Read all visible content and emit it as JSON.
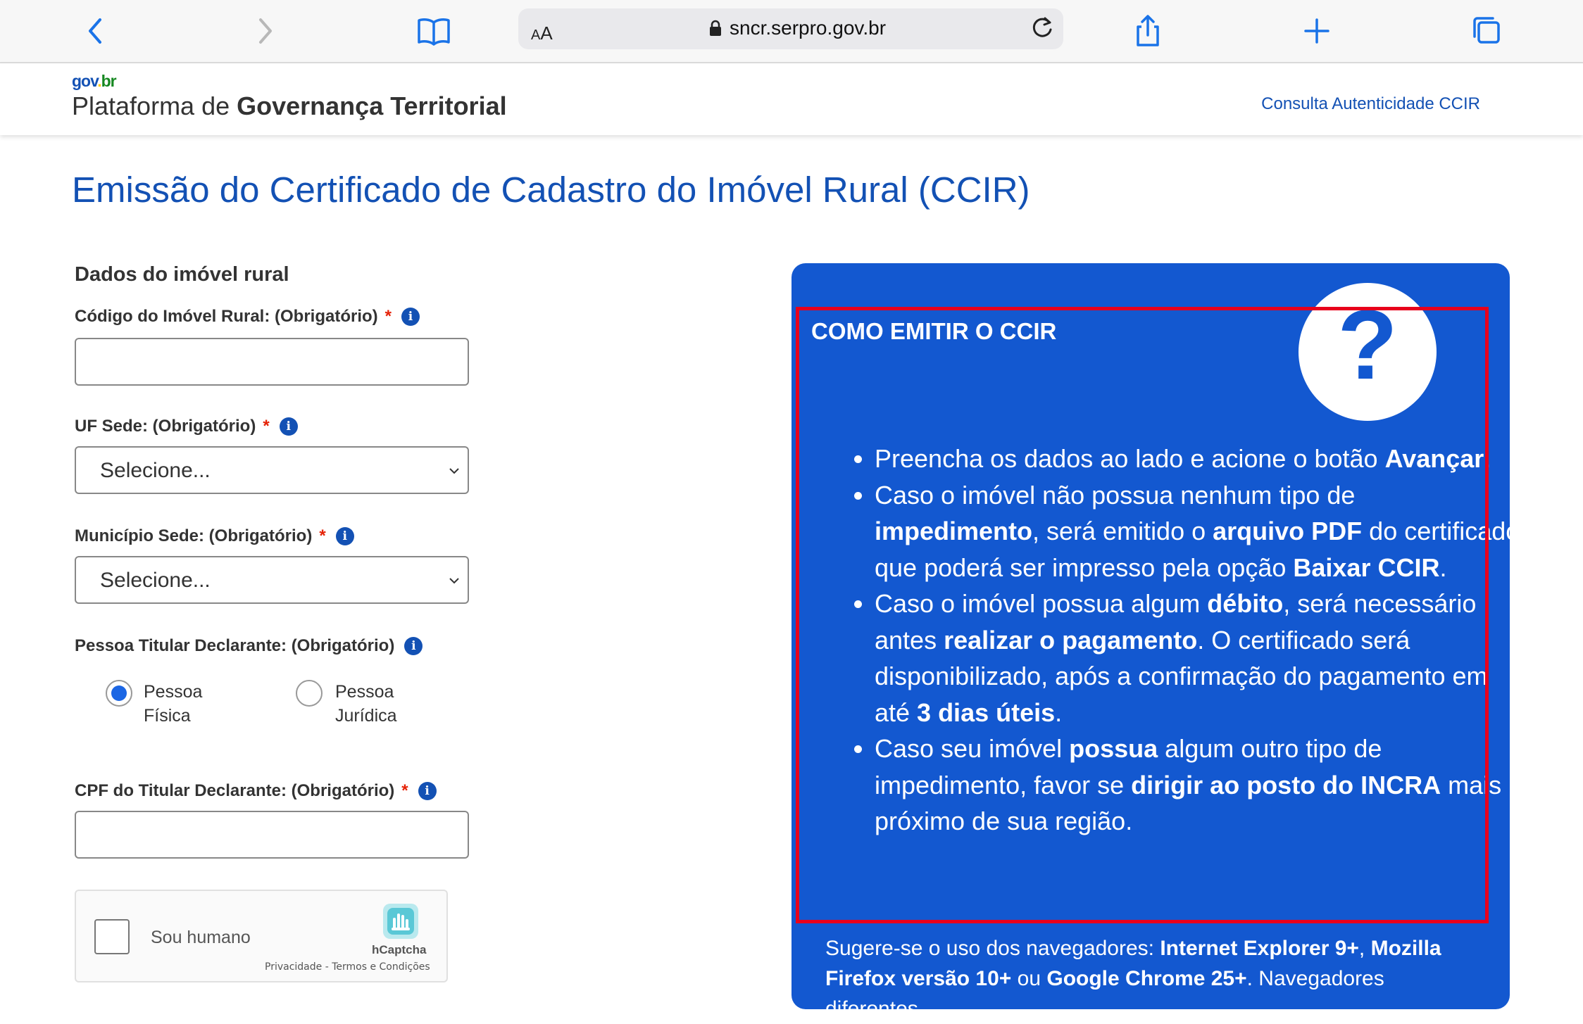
{
  "browser": {
    "address_prefix_small": "A",
    "address_prefix": "A",
    "url": "sncr.serpro.gov.br",
    "icons": [
      "back-icon",
      "forward-icon",
      "bookmarks-icon",
      "lock-icon",
      "reload-icon",
      "share-icon",
      "new-tab-icon",
      "tabs-icon"
    ]
  },
  "header": {
    "logo_gov": "gov",
    "logo_dot": ".",
    "logo_br": "br",
    "platform_prefix": "Plataforma de ",
    "platform_bold": "Governança Territorial",
    "auth_link": "Consulta Autenticidade CCIR"
  },
  "page": {
    "title": "Emissão do Certificado de Cadastro do Imóvel Rural (CCIR)"
  },
  "form": {
    "section_title": "Dados do imóvel rural",
    "required_mark": "*",
    "info_glyph": "i",
    "codigo_label": "Código do Imóvel Rural: (Obrigatório)",
    "codigo_value": "",
    "uf_label": "UF Sede: (Obrigatório)",
    "uf_value": "Selecione...",
    "municipio_label": "Município Sede: (Obrigatório)",
    "municipio_value": "Selecione...",
    "pessoa_label": "Pessoa Titular Declarante: (Obrigatório)",
    "pessoa_options": [
      {
        "line1": "Pessoa",
        "line2": "Física",
        "selected": true
      },
      {
        "line1": "Pessoa",
        "line2": "Jurídica",
        "selected": false
      }
    ],
    "cpf_label": "CPF do Titular Declarante: (Obrigatório)",
    "cpf_value": "",
    "captcha": {
      "label": "Sou humano",
      "brand": "hCaptcha",
      "links": "Privacidade - Termos e Condições"
    }
  },
  "help_panel": {
    "title": "COMO EMITIR O CCIR",
    "question_glyph": "?",
    "tip1_a": "Preencha os dados ao lado e acione o botão ",
    "tip1_b": "Avançar",
    "tip1_c": ".",
    "tip2_a": "Caso o imóvel não possua nenhum tipo de ",
    "tip2_b": "impedimento",
    "tip2_c": ", será emitido o ",
    "tip2_d": "arquivo PDF",
    "tip2_e": " do certificado que poderá ser impresso pela opção ",
    "tip2_f": "Baixar CCIR",
    "tip2_g": ".",
    "tip3_a": "Caso o imóvel possua algum ",
    "tip3_b": "débito",
    "tip3_c": ", será necessário antes ",
    "tip3_d": "realizar o pagamento",
    "tip3_e": ". O certificado será disponibilizado, após a confirmação do pagamento em até ",
    "tip3_f": "3 dias úteis",
    "tip3_g": ".",
    "tip4_a": "Caso seu imóvel ",
    "tip4_b": "possua",
    "tip4_c": " algum outro tipo de impedimento, favor se ",
    "tip4_d": "dirigir ao posto do INCRA",
    "tip4_e": " mais próximo de sua região.",
    "browsers_a": "Sugere-se o uso dos navegadores: ",
    "browsers_b": "Internet Explorer 9+",
    "browsers_c": ", ",
    "browsers_d": "Mozilla Firefox versão 10+",
    "browsers_e": " ou ",
    "browsers_f": "Google Chrome 25+",
    "browsers_g": ". Navegadores diferentes"
  },
  "colors": {
    "brand_blue": "#1351b4",
    "panel_blue": "#1358d0",
    "highlight_red": "#e8001c",
    "required_red": "#e52207",
    "radio_blue": "#1b66e4"
  }
}
